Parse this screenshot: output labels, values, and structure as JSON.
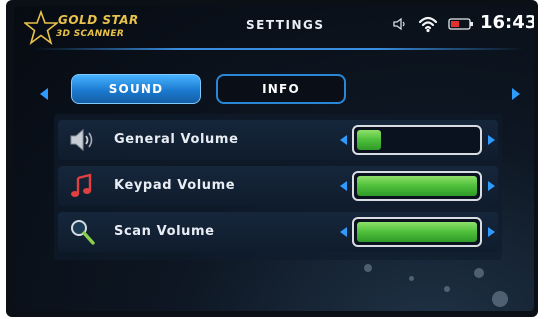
{
  "logo": {
    "line1": "GOLD STAR",
    "line2": "3D SCANNER",
    "icon": "star-icon"
  },
  "header": {
    "title": "SETTINGS",
    "clock": "16:43",
    "status_icons": [
      "speaker-icon",
      "wifi-icon",
      "battery-icon"
    ]
  },
  "tabs": [
    {
      "label": "SOUND",
      "active": true
    },
    {
      "label": "INFO",
      "active": false
    }
  ],
  "settings": [
    {
      "label": "General Volume",
      "icon": "speaker-icon",
      "level": 0.2
    },
    {
      "label": "Keypad Volume",
      "icon": "music-note-icon",
      "level": 1.0
    },
    {
      "label": "Scan Volume",
      "icon": "magnifier-icon",
      "level": 1.0
    }
  ],
  "colors": {
    "accent": "#2f9bff",
    "logo_gold": "#e8c24a",
    "slider_fill": "#4cbf3a",
    "battery": "#e03030"
  }
}
